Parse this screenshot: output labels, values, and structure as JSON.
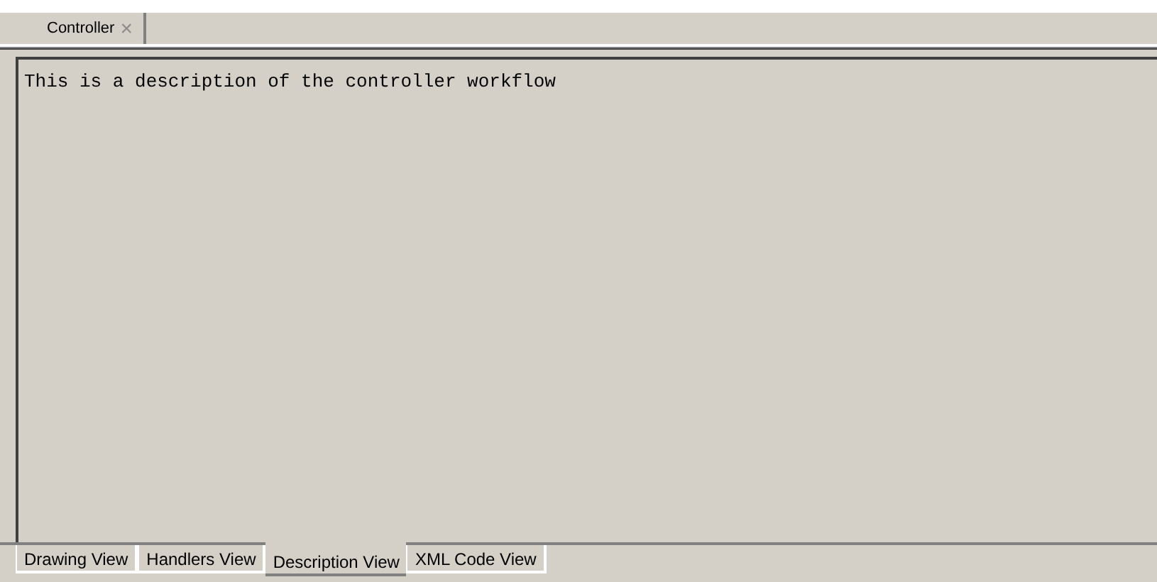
{
  "editor_tab": {
    "label": "Controller",
    "close": "×"
  },
  "description": {
    "value": "This is a description of the controller workflow"
  },
  "view_tabs": [
    {
      "label": "Drawing View",
      "selected": false
    },
    {
      "label": "Handlers View",
      "selected": false
    },
    {
      "label": "Description View",
      "selected": true
    },
    {
      "label": "XML Code View",
      "selected": false
    }
  ]
}
